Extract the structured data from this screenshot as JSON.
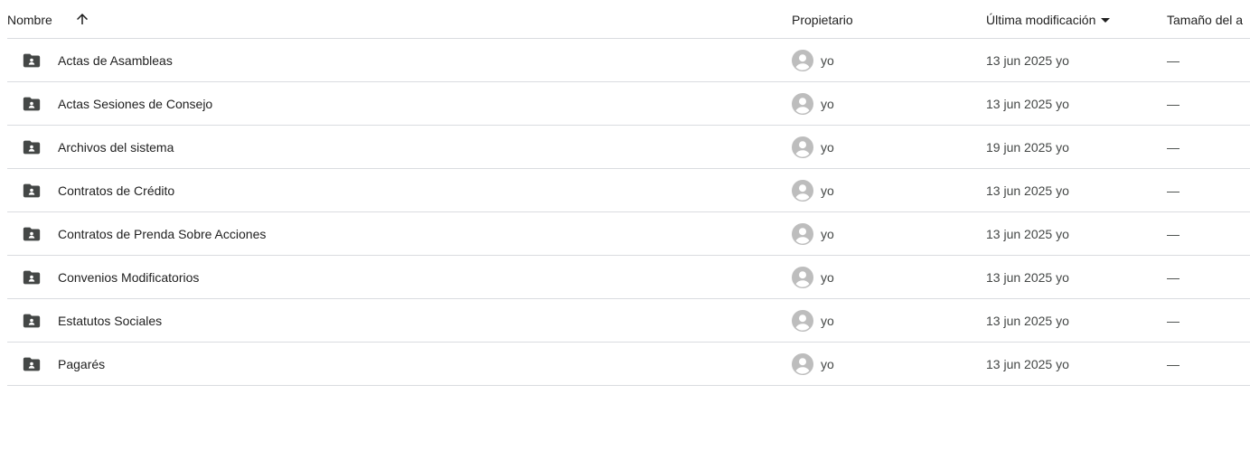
{
  "columns": {
    "name": "Nombre",
    "owner": "Propietario",
    "modified": "Última modificación",
    "size": "Tamaño del a"
  },
  "icons": {
    "sort": "arrow-upward-icon",
    "sort_menu": "caret-down-icon",
    "folder": "shared-folder-icon",
    "owner_avatar": "account-circle-icon"
  },
  "colors": {
    "folder_icon": "#444746",
    "avatar": "#bdbdbd",
    "divider": "#dadce0"
  },
  "rows": [
    {
      "name": "Actas de Asambleas",
      "owner": "yo",
      "modified": "13 jun 2025 yo",
      "size": "—"
    },
    {
      "name": "Actas Sesiones de Consejo",
      "owner": "yo",
      "modified": "13 jun 2025 yo",
      "size": "—"
    },
    {
      "name": "Archivos del sistema",
      "owner": "yo",
      "modified": "19 jun 2025 yo",
      "size": "—"
    },
    {
      "name": "Contratos de Crédito",
      "owner": "yo",
      "modified": "13 jun 2025 yo",
      "size": "—"
    },
    {
      "name": "Contratos de Prenda Sobre Acciones",
      "owner": "yo",
      "modified": "13 jun 2025 yo",
      "size": "—"
    },
    {
      "name": "Convenios Modificatorios",
      "owner": "yo",
      "modified": "13 jun 2025 yo",
      "size": "—"
    },
    {
      "name": "Estatutos Sociales",
      "owner": "yo",
      "modified": "13 jun 2025 yo",
      "size": "—"
    },
    {
      "name": "Pagarés",
      "owner": "yo",
      "modified": "13 jun 2025 yo",
      "size": "—"
    }
  ]
}
